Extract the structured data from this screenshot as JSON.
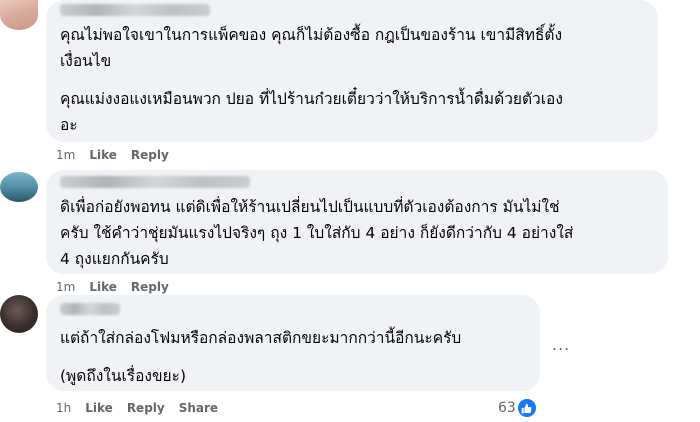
{
  "comments": [
    {
      "paragraphs": [
        "คุณไม่พอใจเขาในการแพ็คของ คุณก็ไม่ต้องซื้อ กฎเป็นของร้าน เขามีสิทธิ์ตั้ง\nเงื่อนไข",
        "คุณแม่งงอแงเหมือนพวก ปยอ ที่ไปร้านก๋วยเตี๋ยวว่าให้บริการน้ำดื่มด้วยตัวเอง\nอะ"
      ],
      "time": "1m",
      "like_label": "Like",
      "reply_label": "Reply"
    },
    {
      "paragraphs": [
        "ดิเพื่อก่อยังพอทน แต่ดิเพื่อให้ร้านเปลี่ยนไปเป็นแบบที่ตัวเองต้องการ มันไม่ใช่\nครับ ใช้คำว่าชุ่ยมันแรงไปจริงๆ ถุง 1 ใบใส่กับ 4 อย่าง ก็ยังดีกว่ากับ 4 อย่างใส่\n4 ถุงแยกกันครับ"
      ],
      "time": "1m",
      "like_label": "Like",
      "reply_label": "Reply"
    },
    {
      "paragraphs": [
        "แต่ถ้าใส่กล่องโฟมหรือกล่องพลาสติกขยะมากกว่านี้อีกนะครับ",
        "(พูดถึงในเรื่องขยะ)"
      ],
      "time": "1h",
      "like_label": "Like",
      "reply_label": "Reply",
      "share_label": "Share",
      "reaction_count": "63",
      "reaction_icon": "thumbs-up-icon",
      "more_label": "..."
    }
  ],
  "colors": {
    "bubble": "#f0f2f5",
    "text": "#050505",
    "meta": "#65676b",
    "like_blue": "#1877f2"
  }
}
